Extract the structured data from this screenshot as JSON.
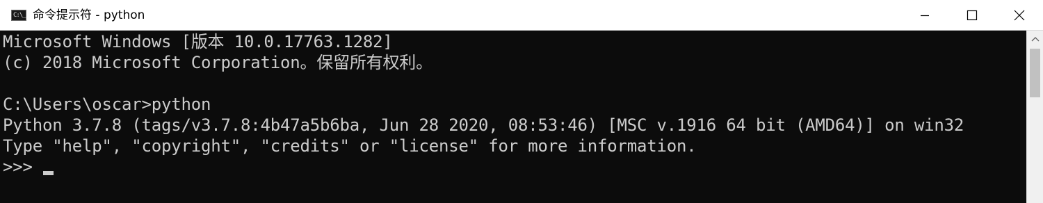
{
  "window": {
    "title": "命令提示符 - python",
    "icon_glyph": "C:\\_"
  },
  "icons": {
    "app": "console-app-icon",
    "minimize": "minimize-icon",
    "maximize": "maximize-icon",
    "close": "close-icon",
    "scroll_up": "chevron-up-icon"
  },
  "console": {
    "lines": [
      "Microsoft Windows [版本 10.0.17763.1282]",
      "(c) 2018 Microsoft Corporation。保留所有权利。",
      "",
      "C:\\Users\\oscar>python",
      "Python 3.7.8 (tags/v3.7.8:4b47a5b6ba, Jun 28 2020, 08:53:46) [MSC v.1916 64 bit (AMD64)] on win32",
      "Type \"help\", \"copyright\", \"credits\" or \"license\" for more information.",
      ">>> "
    ]
  },
  "colors": {
    "console_bg": "#0c0c0c",
    "console_fg": "#cccccc",
    "titlebar_bg": "#ffffff"
  }
}
